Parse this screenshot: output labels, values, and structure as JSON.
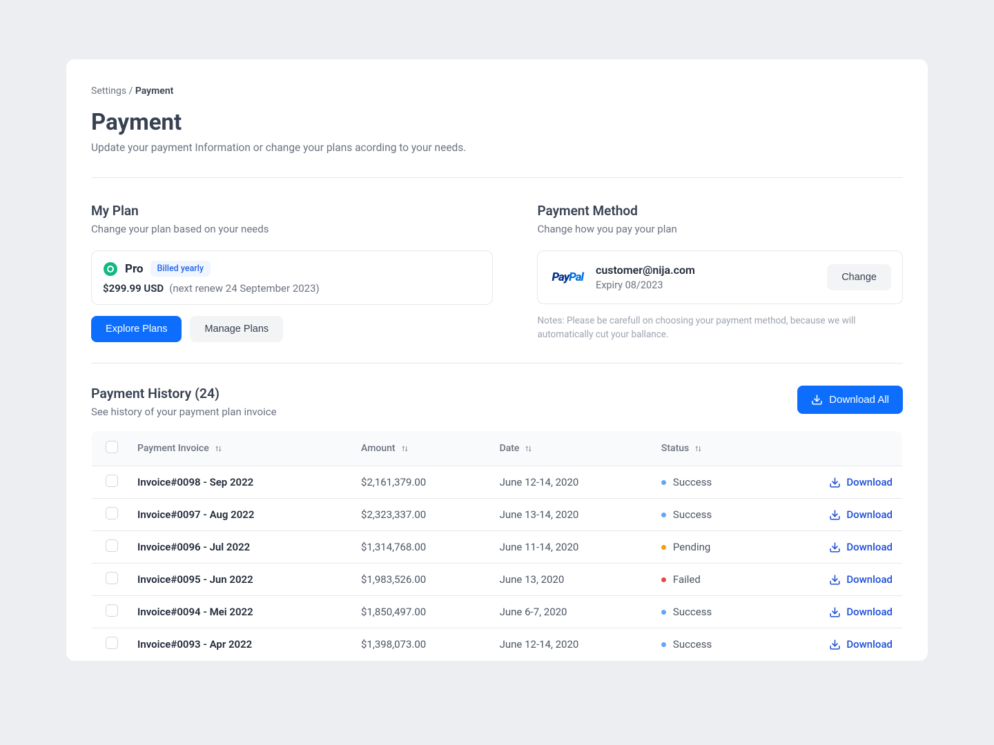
{
  "breadcrumb": {
    "parent": "Settings",
    "sep": " / ",
    "current": "Payment"
  },
  "page": {
    "title": "Payment",
    "subtitle": "Update your payment Information or change your plans acording to your needs."
  },
  "plan": {
    "section_title": "My Plan",
    "section_sub": "Change your plan based on your needs",
    "name": "Pro",
    "badge": "Billed yearly",
    "price": "$299.99 USD",
    "renew": "(next renew 24 September 2023)",
    "explore_btn": "Explore Plans",
    "manage_btn": "Manage Plans"
  },
  "method": {
    "section_title": "Payment Method",
    "section_sub": "Change how you pay your plan",
    "provider_pay": "Pay",
    "provider_pal": "Pal",
    "email": "customer@nija.com",
    "expiry": "Expiry 08/2023",
    "change_btn": "Change",
    "notes": "Notes: Please be carefull on choosing your payment method, because we will automatically cut your ballance."
  },
  "history": {
    "title": "Payment History (24)",
    "sub": "See history of your payment plan invoice",
    "download_all": "Download All",
    "columns": {
      "invoice": "Payment Invoice",
      "amount": "Amount",
      "date": "Date",
      "status": "Status"
    },
    "row_download": "Download",
    "rows": [
      {
        "name": "Invoice#0098 - Sep 2022",
        "amount": "$2,161,379.00",
        "date": "June 12-14, 2020",
        "status": "Success",
        "status_kind": "success"
      },
      {
        "name": "Invoice#0097 - Aug 2022",
        "amount": "$2,323,337.00",
        "date": "June 13-14, 2020",
        "status": "Success",
        "status_kind": "success"
      },
      {
        "name": "Invoice#0096 - Jul 2022",
        "amount": "$1,314,768.00",
        "date": "June 11-14, 2020",
        "status": "Pending",
        "status_kind": "pending"
      },
      {
        "name": "Invoice#0095 - Jun 2022",
        "amount": "$1,983,526.00",
        "date": "June 13, 2020",
        "status": "Failed",
        "status_kind": "failed"
      },
      {
        "name": "Invoice#0094 - Mei 2022",
        "amount": "$1,850,497.00",
        "date": "June 6-7, 2020",
        "status": "Success",
        "status_kind": "success"
      },
      {
        "name": "Invoice#0093 - Apr 2022",
        "amount": "$1,398,073.00",
        "date": "June 12-14, 2020",
        "status": "Success",
        "status_kind": "success"
      }
    ]
  }
}
